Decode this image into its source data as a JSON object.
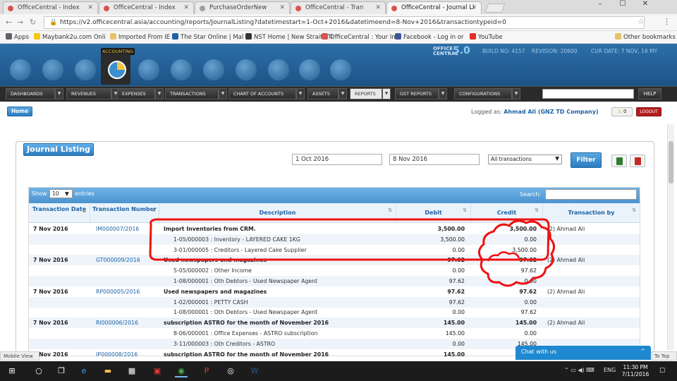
{
  "browser": {
    "tabs": [
      {
        "title": "OfficeCentral - Index"
      },
      {
        "title": "OfficeCentral - Index"
      },
      {
        "title": "PurchaseOrderNew"
      },
      {
        "title": "OfficeCentral - Tran"
      },
      {
        "title": "OfficeCentral - Journal Li"
      }
    ],
    "url": "https://v2.officecentral.asia/accounting/reports/JournalListing?datetimestart=1-Oct+2016&datetimeend=8-Nov+2016&transactiontypeid=0",
    "bookmarks": [
      "Apps",
      "Maybank2u.com Onli",
      "Imported From IE",
      "The Star Online | Mal",
      "NST Home | New Straits Ti",
      "OfficeCentral : Your In",
      "Facebook - Log in or",
      "YouTube",
      "Other bookmarks"
    ],
    "window_min": "–",
    "window_max": "☐",
    "window_close": "✕"
  },
  "app": {
    "module_label": "ACCOUNTING",
    "logo_line1": "OFFICE",
    "logo_line2": "CENTRAL",
    "version": "5.0",
    "header_info": [
      "BUILD NO: 4157",
      "REVISION: 20600",
      "CUR DATE: 7 NOV, 16 MY"
    ],
    "menu": [
      "DASHBOARDS",
      "REVENUES",
      "EXPENSES",
      "TRANSACTIONS",
      "CHART OF ACCOUNTS",
      "ASSETS",
      "REPORTS",
      "GST REPORTS",
      "CONFIGURATIONS"
    ],
    "help": "HELP",
    "home": "Home",
    "logged_prefix": "Logged as:",
    "logged_user": "Ahmad Ali (GNZ TD Company)",
    "notif_count": "0",
    "logout": "LOGOUT"
  },
  "journal": {
    "title": "Journal Listing",
    "date_from": "1 Oct 2016",
    "date_to": "8 Nov 2016",
    "tx_type": "All transactions",
    "filter": "Filter",
    "show_label": "Show",
    "show_value": "10",
    "entries_label": "entries",
    "search_label": "Search:",
    "columns": [
      "Transaction Date",
      "Transaction Number",
      "Description",
      "Debit",
      "Credit",
      "Transaction by"
    ]
  },
  "rows": [
    {
      "date": "7 Nov 2016",
      "num": "IM000007/2016",
      "desc": "Import Inventories from CRM.",
      "debit": "3,500.00",
      "credit": "3,500.00",
      "by": "(2) Ahmad Ali",
      "main": true
    },
    {
      "date": "",
      "num": "",
      "desc": "1-05/000003 : Inventory - LAYERED CAKE 1KG",
      "debit": "3,500.00",
      "credit": "0.00",
      "by": "",
      "main": false
    },
    {
      "date": "",
      "num": "",
      "desc": "3-01/000005 : Creditors - Layered Cake Supplier",
      "debit": "0.00",
      "credit": "3,500.00",
      "by": "",
      "main": false
    },
    {
      "date": "7 Nov 2016",
      "num": "GT000009/2016",
      "desc": "Used newspapers and magazines",
      "debit": "97.62",
      "credit": "97.62",
      "by": "(2) Ahmad Ali",
      "main": true
    },
    {
      "date": "",
      "num": "",
      "desc": "5-05/000002 : Other Income",
      "debit": "0.00",
      "credit": "97.62",
      "by": "",
      "main": false
    },
    {
      "date": "",
      "num": "",
      "desc": "1-08/000001 : Oth Debtors - Used Newspaper Agent",
      "debit": "97.62",
      "credit": "0.00",
      "by": "",
      "main": false
    },
    {
      "date": "7 Nov 2016",
      "num": "RP000005/2016",
      "desc": "Used newspapers and magazines",
      "debit": "97.62",
      "credit": "97.62",
      "by": "(2) Ahmad Ali",
      "main": true
    },
    {
      "date": "",
      "num": "",
      "desc": "1-02/000001 : PETTY CASH",
      "debit": "97.62",
      "credit": "0.00",
      "by": "",
      "main": false
    },
    {
      "date": "",
      "num": "",
      "desc": "1-08/000001 : Oth Debtors - Used Newspaper Agent",
      "debit": "0.00",
      "credit": "97.62",
      "by": "",
      "main": false
    },
    {
      "date": "7 Nov 2016",
      "num": "RI000006/2016",
      "desc": "subscription ASTRO for the month of November 2016",
      "debit": "145.00",
      "credit": "145.00",
      "by": "(2) Ahmad Ali",
      "main": true
    },
    {
      "date": "",
      "num": "",
      "desc": "8-06/000001 : Office Expenses - ASTRO subscription",
      "debit": "145.00",
      "credit": "0.00",
      "by": "",
      "main": false
    },
    {
      "date": "",
      "num": "",
      "desc": "3-11/000003 : Oth Creditors - ASTRO",
      "debit": "0.00",
      "credit": "145.00",
      "by": "",
      "main": false
    },
    {
      "date": "7 Nov 2016",
      "num": "IP000008/2016",
      "desc": "subscription ASTRO for the month of November 2016",
      "debit": "145.00",
      "credit": "145.00",
      "by": "",
      "main": true
    }
  ],
  "widgets": {
    "chat": "Chat with us",
    "mobile_view": "Mobile View",
    "to_top": "To Top"
  },
  "taskbar": {
    "lang": "ENG",
    "time": "11:30 PM",
    "date": "7/11/2016"
  }
}
